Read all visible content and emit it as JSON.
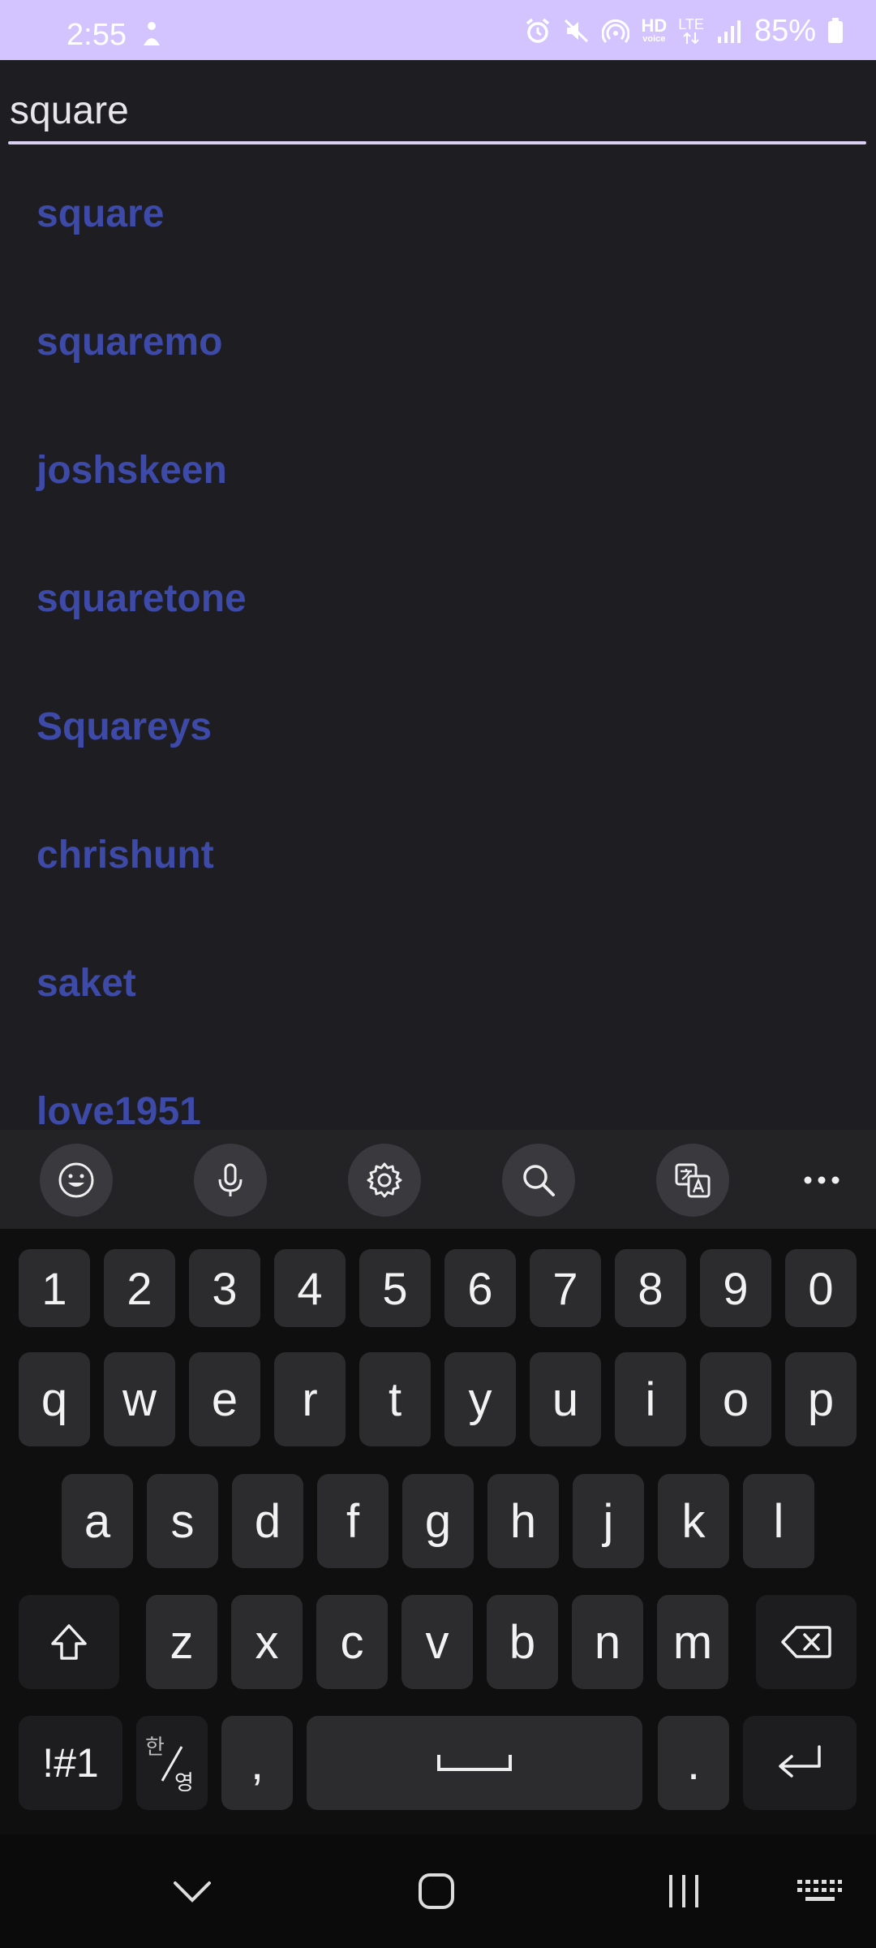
{
  "status_bar": {
    "time": "2:55",
    "battery_percent": "85%",
    "signal_text_hd": "HD",
    "signal_text_voice": "voice",
    "signal_text_lte": "LTE",
    "icons": [
      "person-icon",
      "alarm-icon",
      "mute-icon",
      "hotspot-icon",
      "hd-voice-icon",
      "lte-icon",
      "signal-icon",
      "battery-icon"
    ]
  },
  "search": {
    "value": "square"
  },
  "results": [
    {
      "label": "square"
    },
    {
      "label": "squaremo"
    },
    {
      "label": "joshskeen"
    },
    {
      "label": "squaretone"
    },
    {
      "label": "Squareys"
    },
    {
      "label": "chrishunt"
    },
    {
      "label": "saket"
    },
    {
      "label": "love1951"
    }
  ],
  "keyboard_toolbar": {
    "icons": [
      "emoji-icon",
      "microphone-icon",
      "settings-icon",
      "search-icon",
      "translate-icon",
      "more-icon"
    ]
  },
  "keyboard": {
    "number_row": [
      "1",
      "2",
      "3",
      "4",
      "5",
      "6",
      "7",
      "8",
      "9",
      "0"
    ],
    "row1": [
      "q",
      "w",
      "e",
      "r",
      "t",
      "y",
      "u",
      "i",
      "o",
      "p"
    ],
    "row2": [
      "a",
      "s",
      "d",
      "f",
      "g",
      "h",
      "j",
      "k",
      "l"
    ],
    "row3": [
      "z",
      "x",
      "c",
      "v",
      "b",
      "n",
      "m"
    ],
    "symbols_label": "!#1",
    "lang_top": "한",
    "lang_bottom": "영",
    "comma": ",",
    "period": "."
  },
  "navbar": {
    "icons": [
      "hide-keyboard-icon",
      "home-icon",
      "recents-icon",
      "keyboard-switch-icon"
    ]
  },
  "colors": {
    "status_bar_bg": "#d3c4ff",
    "background": "#1e1e22",
    "result_text": "#3d4aa8",
    "key_bg": "#2c2c2f",
    "keyboard_bg": "#0f0f10"
  }
}
